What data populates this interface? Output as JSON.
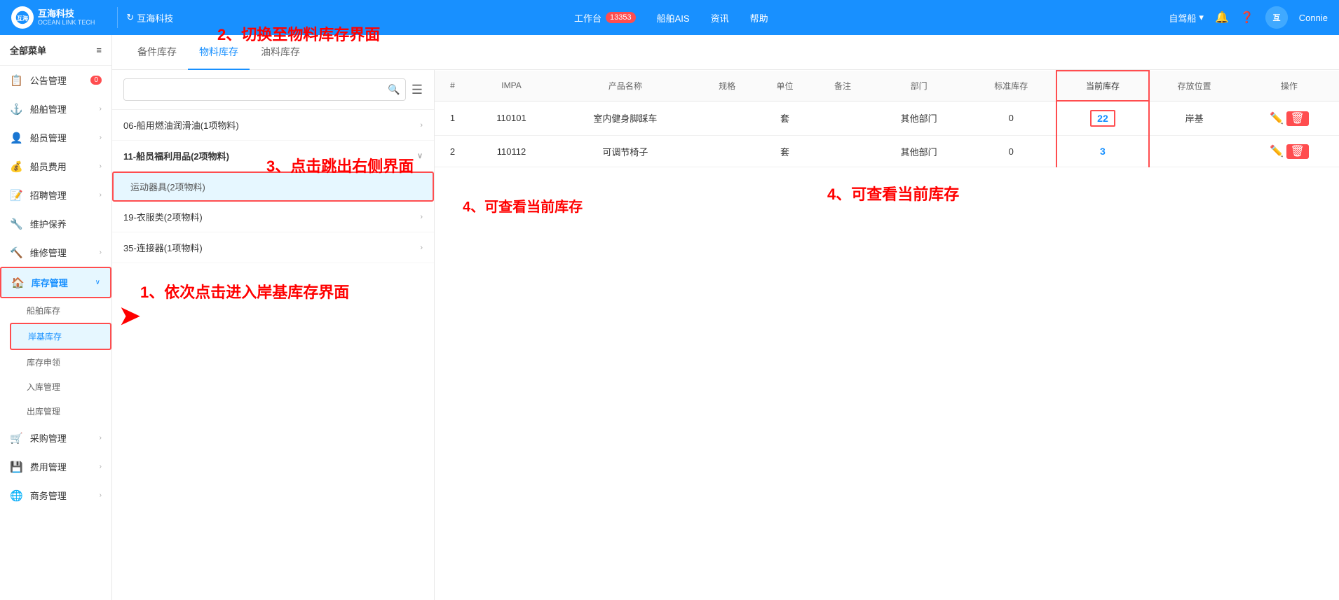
{
  "topnav": {
    "logo_text": "互海科技",
    "logo_sub": "OCEAN LINK TECH",
    "site_icon": "⊙",
    "site_label": "互海科技",
    "workbench": "工作台",
    "badge": "13353",
    "links": [
      "船舶AIS",
      "资讯",
      "帮助"
    ],
    "self_ship": "自驾船",
    "user": "Connie"
  },
  "sidebar": {
    "header": "全部菜单",
    "items": [
      {
        "id": "announcement",
        "icon": "📋",
        "label": "公告管理",
        "badge": "0",
        "arrow": false
      },
      {
        "id": "ship",
        "icon": "⚓",
        "label": "船舶管理",
        "arrow": true
      },
      {
        "id": "crew",
        "icon": "👤",
        "label": "船员管理",
        "arrow": true
      },
      {
        "id": "crew-fee",
        "icon": "💰",
        "label": "船员费用",
        "arrow": true
      },
      {
        "id": "recruit",
        "icon": "📝",
        "label": "招聘管理",
        "arrow": true
      },
      {
        "id": "maintain",
        "icon": "🔧",
        "label": "维护保养",
        "arrow": false
      },
      {
        "id": "repair",
        "icon": "🔨",
        "label": "维修管理",
        "arrow": true
      },
      {
        "id": "inventory",
        "icon": "🏠",
        "label": "库存管理",
        "arrow": true,
        "active": true
      }
    ],
    "inventory_sub": [
      {
        "id": "ship-inventory",
        "label": "船舶库存"
      },
      {
        "id": "shore-inventory",
        "label": "岸基库存",
        "active": true
      },
      {
        "id": "stock-requisition",
        "label": "库存申领"
      },
      {
        "id": "inbound",
        "label": "入库管理"
      },
      {
        "id": "outbound",
        "label": "出库管理"
      }
    ],
    "more_items": [
      {
        "id": "purchase",
        "icon": "🛒",
        "label": "采购管理",
        "arrow": true
      },
      {
        "id": "finance",
        "icon": "💾",
        "label": "费用管理",
        "arrow": true
      },
      {
        "id": "business",
        "icon": "🌐",
        "label": "商务管理",
        "arrow": true
      }
    ]
  },
  "tabs": [
    {
      "id": "parts",
      "label": "备件库存"
    },
    {
      "id": "materials",
      "label": "物料库存",
      "active": true
    },
    {
      "id": "oil",
      "label": "油料库存"
    }
  ],
  "search": {
    "placeholder": "",
    "search_icon": "🔍",
    "filter_icon": "☰"
  },
  "categories": [
    {
      "id": "cat1",
      "label": "06-船用燃油润滑油(1项物料)",
      "expanded": false,
      "arrow": "›"
    },
    {
      "id": "cat2",
      "label": "11-船员福利用品(2项物料)",
      "expanded": true,
      "arrow": "∨",
      "children": [
        {
          "id": "sub1",
          "label": "运动器具(2项物料)",
          "selected": true
        }
      ]
    },
    {
      "id": "cat3",
      "label": "19-衣服类(2项物料)",
      "expanded": false,
      "arrow": "›"
    },
    {
      "id": "cat4",
      "label": "35-连接器(1项物料)",
      "expanded": false,
      "arrow": "›"
    }
  ],
  "table": {
    "columns": [
      "#",
      "IMPA",
      "产品名称",
      "规格",
      "单位",
      "备注",
      "部门",
      "标准库存",
      "当前库存",
      "存放位置",
      "操作"
    ],
    "rows": [
      {
        "no": "1",
        "impa": "110101",
        "product": "室内健身脚踩车",
        "spec": "",
        "unit": "套",
        "remark": "",
        "dept": "其他部门",
        "std_stock": "0",
        "cur_stock": "22",
        "location": "岸基",
        "highlight": true
      },
      {
        "no": "2",
        "impa": "110112",
        "product": "可调节椅子",
        "spec": "",
        "unit": "套",
        "remark": "",
        "dept": "其他部门",
        "std_stock": "0",
        "cur_stock": "3",
        "location": "",
        "highlight": false
      }
    ]
  },
  "annotations": {
    "ann1": "1、依次点击进入岸基库存界面",
    "ann2": "2、切换至物料库存界面",
    "ann3": "3、点击跳出右侧界面",
    "ann4": "4、可查看当前库存"
  }
}
